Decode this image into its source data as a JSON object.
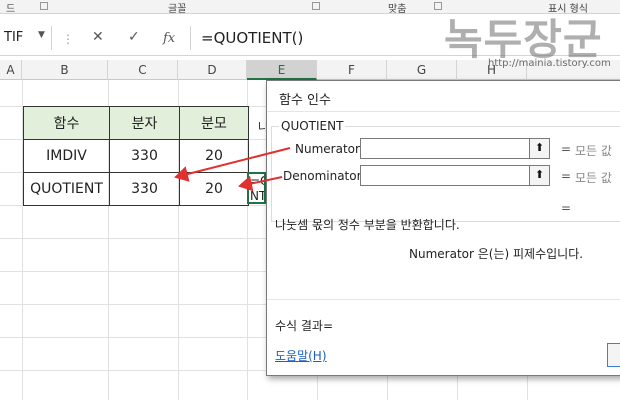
{
  "ribbon": {
    "groups": [
      "드",
      "글꼴",
      "맞춤",
      "표시 형식"
    ]
  },
  "formula_bar": {
    "name_box": "TIF",
    "cancel_glyph": "✕",
    "enter_glyph": "✓",
    "fx_label": "fx",
    "formula": "=QUOTIENT()"
  },
  "columns": [
    "A",
    "B",
    "C",
    "D",
    "E",
    "F",
    "G",
    "H"
  ],
  "table": {
    "headers": [
      "함수",
      "분자",
      "분모"
    ],
    "rows": [
      [
        "IMDIV",
        "330",
        "20"
      ],
      [
        "QUOTIENT",
        "330",
        "20"
      ]
    ]
  },
  "cell_peek": {
    "header_fragment": "나",
    "active_line1": "=Q",
    "active_line2": "NT"
  },
  "dialog": {
    "title": "함수 인수",
    "function_name": "QUOTIENT",
    "args": [
      {
        "label": "Numerator",
        "eq": "=",
        "hint": "모든 값"
      },
      {
        "label": "Denominator",
        "eq": "=",
        "hint": "모든 값"
      }
    ],
    "ref_glyph": "⬆",
    "result_eq": "=",
    "description": "나눗셈 몫의 정수 부분을 반환합니다.",
    "arg_description_name": "Numerator",
    "arg_description_text": "은(는) 피제수입니다.",
    "formula_result_label": "수식 결과=",
    "help_link": "도움말(H)"
  },
  "watermark": {
    "text": "녹두장군",
    "url": "http://mainia.tistory.com"
  },
  "colors": {
    "excel_green": "#217346",
    "header_fill": "#e2efda",
    "arrow_red": "#e03030",
    "link_blue": "#1f5fbf"
  }
}
